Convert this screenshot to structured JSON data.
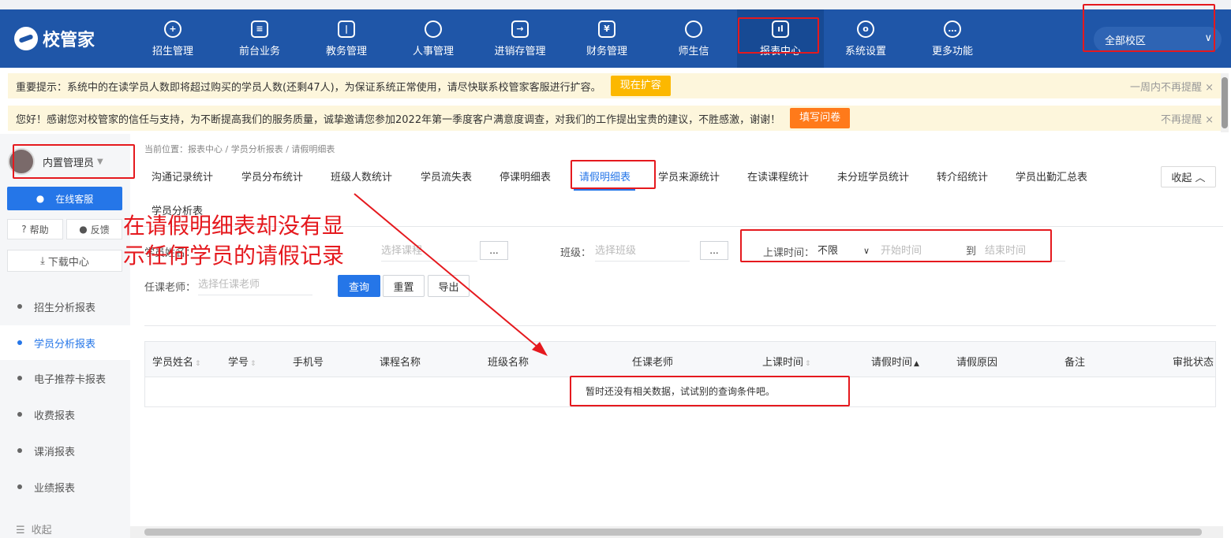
{
  "header": {
    "logo": "校管家",
    "nav": [
      {
        "label": "招生管理",
        "icon": "user-plus-icon"
      },
      {
        "label": "前台业务",
        "icon": "monitor-icon"
      },
      {
        "label": "教务管理",
        "icon": "book-icon"
      },
      {
        "label": "人事管理",
        "icon": "person-icon"
      },
      {
        "label": "进销存管理",
        "icon": "inventory-icon"
      },
      {
        "label": "财务管理",
        "icon": "yen-house-icon"
      },
      {
        "label": "师生信",
        "icon": "chat-icon"
      },
      {
        "label": "报表中心",
        "icon": "report-chart-icon"
      },
      {
        "label": "系统设置",
        "icon": "settings-icon"
      },
      {
        "label": "更多功能",
        "icon": "more-icon"
      }
    ],
    "campus": "全部校区"
  },
  "notices": [
    {
      "text": "重要提示：系统中的在读学员人数即将超过购买的学员人数(还剩47人)，为保证系统正常使用，请尽快联系校管家客服进行扩容。",
      "button": "现在扩容",
      "dismiss": "一周内不再提醒 ×"
    },
    {
      "text": "您好！感谢您对校管家的信任与支持，为不断提高我们的服务质量，诚挚邀请您参加2022年第一季度客户满意度调查，对我们的工作提出宝贵的建议，不胜感激，谢谢！",
      "button": "填写问卷",
      "dismiss": "不再提醒 ×"
    }
  ],
  "sidebar": {
    "user": "内置管理员",
    "service": "在线客服",
    "help": "帮助",
    "feedback": "反馈",
    "download": "下载中心",
    "menu": [
      "招生分析报表",
      "学员分析报表",
      "电子推荐卡报表",
      "收费报表",
      "课消报表",
      "业绩报表"
    ],
    "collapse": "收起"
  },
  "breadcrumb": "当前位置：报表中心 / 学员分析报表 / 请假明细表",
  "tabs": [
    "沟通记录统计",
    "学员分布统计",
    "班级人数统计",
    "学员流失表",
    "停课明细表",
    "请假明细表",
    "学员来源统计",
    "在读课程统计",
    "未分班学员统计",
    "转介绍统计",
    "学员出勤汇总表",
    "学员分析表"
  ],
  "collapse_btn": "收起 ︿",
  "filters": {
    "student_label": "学员姓名：",
    "course_placeholder": "选择课程",
    "class_label": "班级：",
    "class_placeholder": "选择班级",
    "time_label": "上课时间：",
    "time_value": "不限",
    "start_placeholder": "开始时间",
    "to": "到",
    "end_placeholder": "结束时间",
    "teacher_label": "任课老师：",
    "teacher_placeholder": "选择任课老师",
    "dots": "...",
    "query": "查询",
    "reset": "重置",
    "export": "导出"
  },
  "table": {
    "columns": [
      "学员姓名",
      "学号",
      "手机号",
      "课程名称",
      "班级名称",
      "任课老师",
      "上课时间",
      "请假时间",
      "请假原因",
      "备注",
      "审批状态"
    ],
    "empty": "暂时还没有相关数据，试试别的查询条件吧。"
  },
  "annotation": [
    "在请假明细表却没有显",
    "示任何学员的请假记录"
  ],
  "colors": {
    "header": "#1f56a8",
    "accent": "#2576e8",
    "annotation": "#e5191e"
  }
}
